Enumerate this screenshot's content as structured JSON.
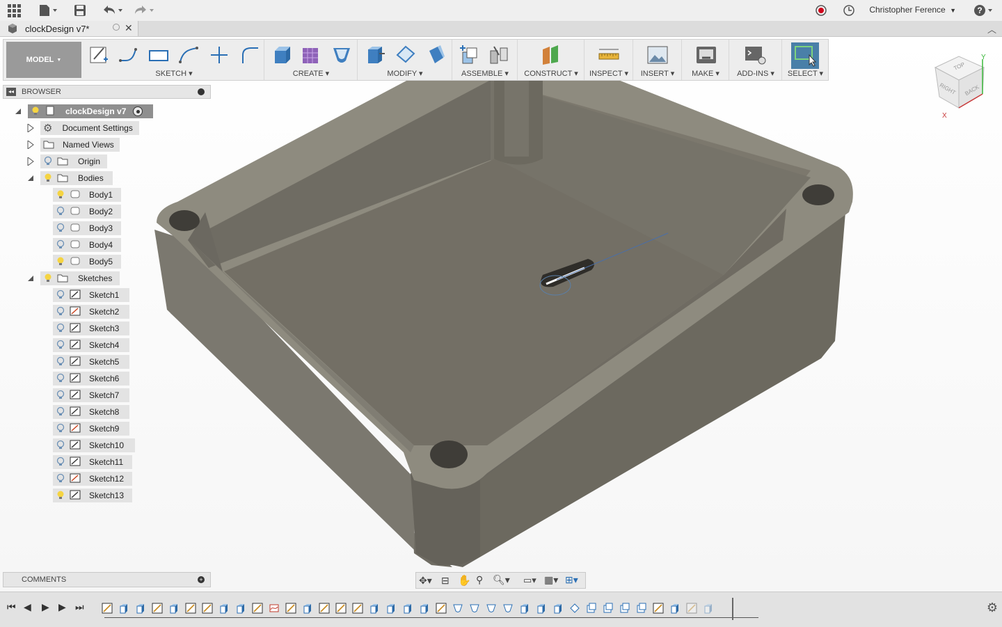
{
  "app": {
    "user_name": "Christopher Ference",
    "document_tab": "clockDesign v7*"
  },
  "toolbar": {
    "workspace": "MODEL",
    "groups": [
      {
        "label": "SKETCH"
      },
      {
        "label": "CREATE"
      },
      {
        "label": "MODIFY"
      },
      {
        "label": "ASSEMBLE"
      },
      {
        "label": "CONSTRUCT"
      },
      {
        "label": "INSPECT"
      },
      {
        "label": "INSERT"
      },
      {
        "label": "MAKE"
      },
      {
        "label": "ADD-INS"
      },
      {
        "label": "SELECT"
      }
    ]
  },
  "browser": {
    "title": "BROWSER",
    "root": "clockDesign v7",
    "document_settings": "Document Settings",
    "named_views": "Named Views",
    "origin": "Origin",
    "bodies": {
      "label": "Bodies",
      "items": [
        "Body1",
        "Body2",
        "Body3",
        "Body4",
        "Body5"
      ]
    },
    "sketches": {
      "label": "Sketches",
      "items": [
        "Sketch1",
        "Sketch2",
        "Sketch3",
        "Sketch4",
        "Sketch5",
        "Sketch6",
        "Sketch7",
        "Sketch8",
        "Sketch9",
        "Sketch10",
        "Sketch11",
        "Sketch12",
        "Sketch13"
      ]
    }
  },
  "comments": {
    "title": "COMMENTS"
  },
  "viewcube": {
    "faces": [
      "TOP",
      "RIGHT",
      "BACK"
    ],
    "axes": [
      "X",
      "Y"
    ]
  },
  "colors": {
    "model_body": "#77746a",
    "model_top": "#8e8b7f",
    "select_active": "#4a7fa8",
    "record_red": "#d0021b"
  }
}
